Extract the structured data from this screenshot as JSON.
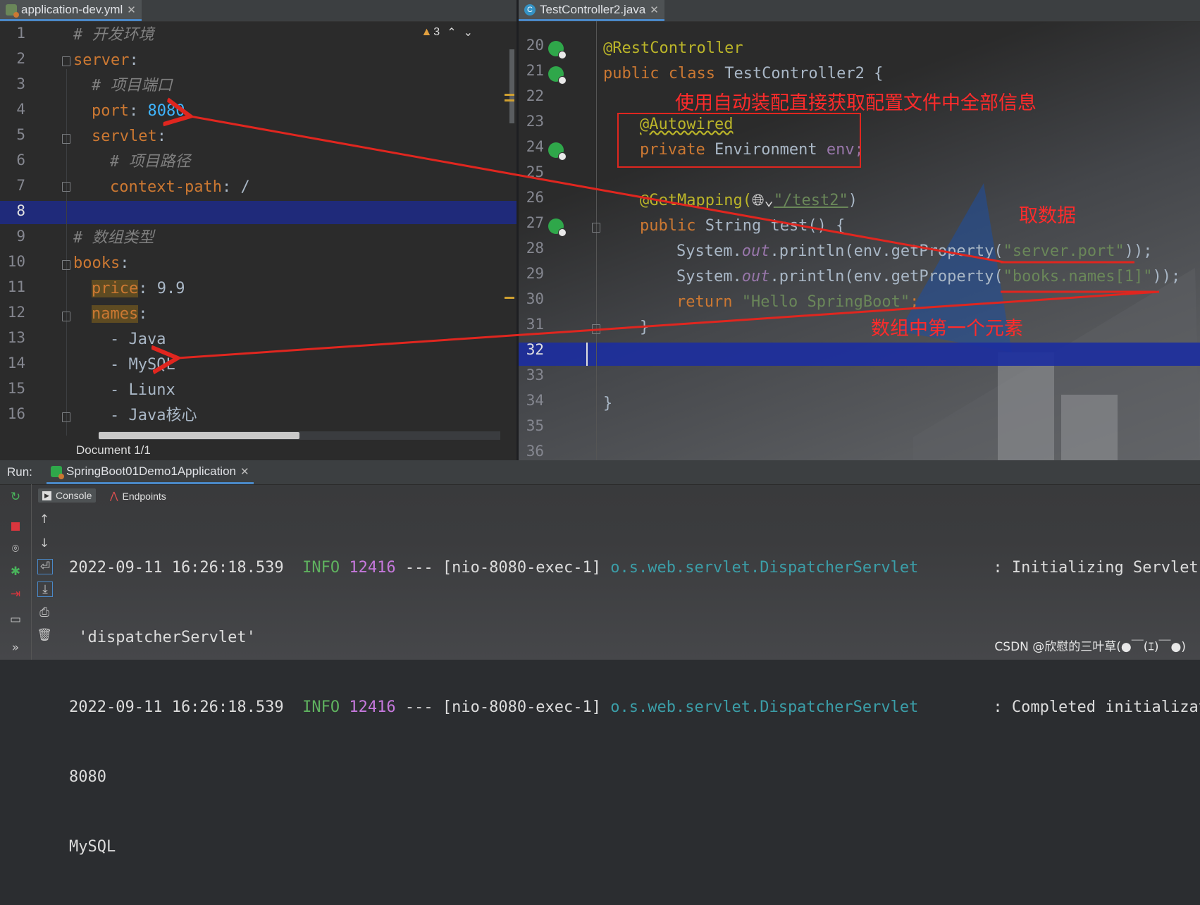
{
  "left_editor": {
    "tab_label": "application-dev.yml",
    "warning_count": "3",
    "line_numbers": [
      "1",
      "2",
      "3",
      "4",
      "5",
      "6",
      "7",
      "8",
      "9",
      "10",
      "11",
      "12",
      "13",
      "14",
      "15",
      "16"
    ],
    "lines": {
      "l1": "# 开发环境",
      "l2_key": "server",
      "l3": "# 项目端口",
      "l4_key": "port",
      "l4_val": "8080",
      "l5_key": "servlet",
      "l6": "# 项目路径",
      "l7_key": "context-path",
      "l7_val": "/",
      "l9": "# 数组类型",
      "l10_key": "books",
      "l11_key": "price",
      "l11_val": "9.9",
      "l12_key": "names",
      "l13": "- Java",
      "l14": "- MySQL",
      "l15": "- Liunx",
      "l16": "- Java核心"
    },
    "status": "Document 1/1"
  },
  "right_editor": {
    "tab_label": "TestController2.java",
    "line_numbers": [
      "20",
      "21",
      "22",
      "23",
      "24",
      "25",
      "26",
      "27",
      "28",
      "29",
      "30",
      "31",
      "32",
      "33",
      "34",
      "35",
      "36"
    ],
    "lines": {
      "l20": "@RestController",
      "l21_kw": "public class",
      "l21_name": "TestController2 {",
      "l23": "@Autowired",
      "l24_kw": "private",
      "l24_type": "Environment",
      "l24_field": "env;",
      "l26_ann": "@GetMapping(",
      "l26_str": "\"/test2\"",
      "l26_end": ")",
      "l27_kw": "public",
      "l27_rest": "String test() {",
      "l28_a": "System.",
      "l28_out": "out",
      "l28_b": ".println(env.getProperty(",
      "l28_str": "\"server.port\"",
      "l28_c": "));",
      "l29_a": "System.",
      "l29_out": "out",
      "l29_b": ".println(env.getProperty(",
      "l29_str": "\"books.names[1]\"",
      "l29_c": "));",
      "l30_kw": "return",
      "l30_str": "\"Hello SpringBoot\"",
      "l30_end": ";",
      "l31": "}",
      "l34": "}"
    }
  },
  "annotations": {
    "autowire_note": "使用自动装配直接获取配置文件中全部信息",
    "fetch_note": "取数据",
    "array_note": "数组中第一个元素"
  },
  "run_panel": {
    "label": "Run:",
    "config_tab": "SpringBoot01Demo1Application",
    "console_tab": "Console",
    "endpoints_tab": "Endpoints",
    "log": [
      {
        "ts": "2022-09-11 16:26:18.539",
        "level": "INFO",
        "pid": "12416",
        "sep": "---",
        "thread": "[nio-8080-exec-1]",
        "logger": "o.s.web.servlet.DispatcherServlet",
        "msg": ": Initializing Servlet"
      },
      {
        "cont": "'dispatcherServlet'"
      },
      {
        "ts": "2022-09-11 16:26:18.539",
        "level": "INFO",
        "pid": "12416",
        "sep": "---",
        "thread": "[nio-8080-exec-1]",
        "logger": "o.s.web.servlet.DispatcherServlet",
        "msg": ": Completed initializatio"
      },
      {
        "out": "8080"
      },
      {
        "out": "MySQL"
      }
    ]
  },
  "watermark": "CSDN @欣慰的三叶草(●￣(ｴ)￣●)",
  "colors": {
    "annotation_red": "#ff2b2b",
    "current_line": "#1f2a7a",
    "accent_tab": "#4a88c7"
  }
}
